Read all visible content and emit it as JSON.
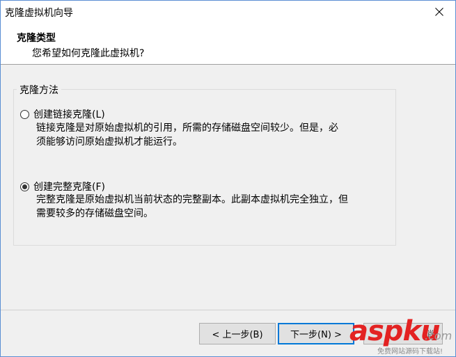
{
  "window": {
    "title": "克隆虚拟机向导",
    "close_icon": "close-icon"
  },
  "header": {
    "title": "克隆类型",
    "subtitle": "您希望如何克隆此虚拟机?"
  },
  "clone_method": {
    "legend": "克隆方法",
    "options": [
      {
        "label": "创建链接克隆(L)",
        "checked": false,
        "description_line1": "链接克隆是对原始虚拟机的引用，所需的存储磁盘空间较少。但是，必",
        "description_line2": "须能够访问原始虚拟机才能运行。"
      },
      {
        "label": "创建完整克隆(F)",
        "checked": true,
        "description_line1": "完整克隆是原始虚拟机当前状态的完整副本。此副本虚拟机完全独立，但",
        "description_line2": "需要较多的存储磁盘空间。"
      }
    ]
  },
  "footer": {
    "back_label": "< 上一步(B)",
    "next_label": "下一步(N) >",
    "cancel_label": "消"
  },
  "watermark": {
    "brand_a": "asp",
    "brand_b": "ku",
    "brand_c": ".com",
    "tagline": "免费网站源码下载站!"
  }
}
